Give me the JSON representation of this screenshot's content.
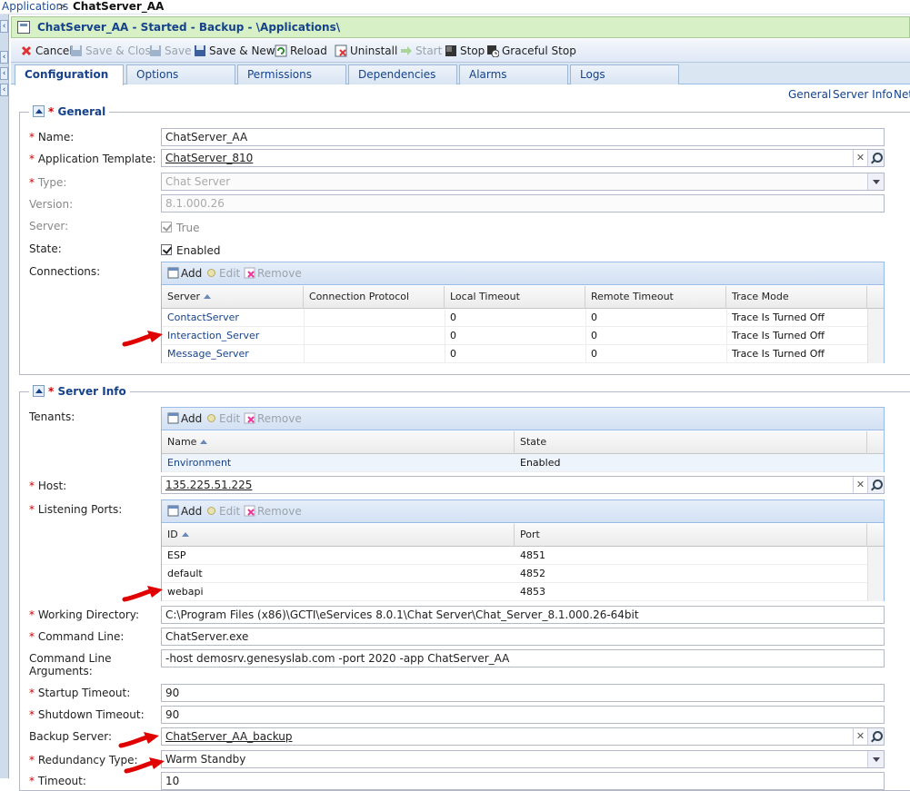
{
  "breadcrumb": {
    "root": "Applications",
    "sep": ">",
    "current": "ChatServer_AA"
  },
  "title": "ChatServer_AA - Started - Backup - \\Applications\\",
  "toolbar": {
    "cancel": "Cancel",
    "save_close": "Save & Close",
    "save": "Save",
    "save_new": "Save & New",
    "reload": "Reload",
    "uninstall": "Uninstall",
    "start": "Start",
    "stop": "Stop",
    "graceful_stop": "Graceful Stop"
  },
  "tabs": [
    "Configuration",
    "Options",
    "Permissions",
    "Dependencies",
    "Alarms",
    "Logs"
  ],
  "section_links": [
    "General",
    "Server Info",
    "Net"
  ],
  "general": {
    "legend": "General",
    "name_label": "Name:",
    "name_value": "ChatServer_AA",
    "template_label": "Application Template:",
    "template_value": "ChatServer_810",
    "type_label": "Type:",
    "type_value": "Chat Server",
    "version_label": "Version:",
    "version_value": "8.1.000.26",
    "server_label": "Server:",
    "server_value": "True",
    "state_label": "State:",
    "state_value": "Enabled",
    "connections_label": "Connections:"
  },
  "grid_buttons": {
    "add": "Add",
    "edit": "Edit",
    "remove": "Remove"
  },
  "connections": {
    "columns": [
      "Server",
      "Connection Protocol",
      "Local Timeout",
      "Remote Timeout",
      "Trace Mode"
    ],
    "rows": [
      [
        "ContactServer",
        "",
        "0",
        "0",
        "Trace Is Turned Off"
      ],
      [
        "Interaction_Server",
        "",
        "0",
        "0",
        "Trace Is Turned Off"
      ],
      [
        "Message_Server",
        "",
        "0",
        "0",
        "Trace Is Turned Off"
      ]
    ]
  },
  "server_info": {
    "legend": "Server Info",
    "tenants_label": "Tenants:",
    "tenants": {
      "columns": [
        "Name",
        "State"
      ],
      "rows": [
        [
          "Environment",
          "Enabled"
        ]
      ]
    },
    "host_label": "Host:",
    "host_value": "135.225.51.225",
    "ports_label": "Listening Ports:",
    "ports": {
      "columns": [
        "ID",
        "Port"
      ],
      "rows": [
        [
          "ESP",
          "4851"
        ],
        [
          "default",
          "4852"
        ],
        [
          "webapi",
          "4853"
        ]
      ]
    },
    "workdir_label": "Working Directory:",
    "workdir_value": "C:\\Program Files (x86)\\GCTI\\eServices 8.0.1\\Chat Server\\Chat_Server_8.1.000.26-64bit",
    "cmdline_label": "Command Line:",
    "cmdline_value": "ChatServer.exe",
    "cmdargs_label_1": "Command Line",
    "cmdargs_label_2": "Arguments:",
    "cmdargs_value": "-host demosrv.genesyslab.com -port 2020 -app ChatServer_AA",
    "startup_label": "Startup Timeout:",
    "startup_value": "90",
    "shutdown_label": "Shutdown Timeout:",
    "shutdown_value": "90",
    "backup_label": "Backup Server:",
    "backup_value": "ChatServer_AA_backup",
    "redundancy_label": "Redundancy Type:",
    "redundancy_value": "Warm Standby",
    "timeout_label": "Timeout:",
    "timeout_value": "10"
  },
  "colors": {
    "link": "#15428b",
    "required": "#cc0000",
    "title_bg": "#d8f0c5",
    "arrow": "#e00000"
  }
}
